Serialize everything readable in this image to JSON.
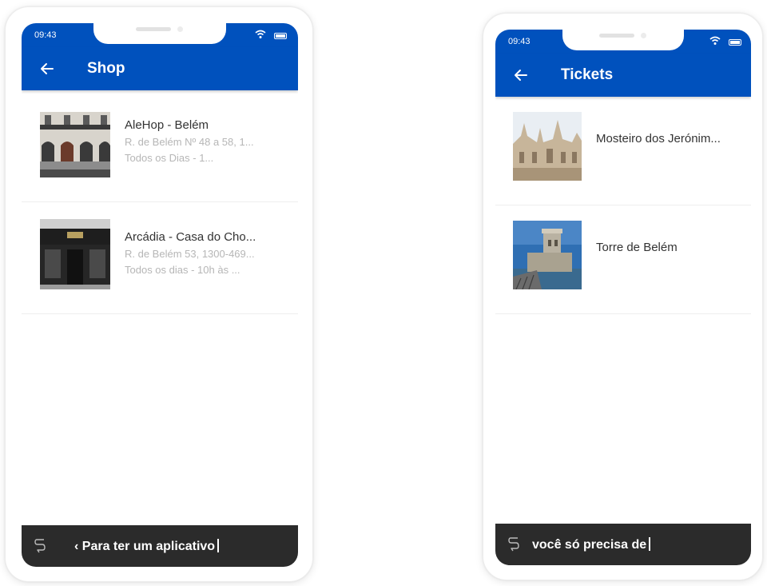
{
  "colors": {
    "app_bar": "#0051bd",
    "bottom_bar": "#2b2b2b",
    "title_text": "#333333",
    "subtitle_text": "#b6b6b6"
  },
  "left_phone": {
    "status": {
      "time": "09:43",
      "icons": [
        "wifi-icon",
        "battery-icon"
      ]
    },
    "app_bar": {
      "title": "Shop",
      "back_icon": "arrow-left-icon"
    },
    "items": [
      {
        "title": "AleHop - Belém",
        "subtitle1": "R. de Belém Nº 48 a 58, 1...",
        "subtitle2": "Todos os Dias - 1...",
        "image": "building-facade"
      },
      {
        "title": "Arcádia - Casa do Cho...",
        "subtitle1": "R. de Belém 53, 1300-469...",
        "subtitle2": "Todos os dias - 10h às ...",
        "image": "shop-front"
      }
    ],
    "bottom_bar": {
      "caption": "‹ Para ter um aplicativo",
      "logo_icon": "s-logo-icon"
    }
  },
  "right_phone": {
    "status": {
      "time": "09:43",
      "icons": [
        "wifi-icon",
        "battery-icon"
      ]
    },
    "app_bar": {
      "title": "Tickets",
      "back_icon": "arrow-left-icon"
    },
    "items": [
      {
        "title": "Mosteiro dos Jerónim...",
        "image": "monastery"
      },
      {
        "title": "Torre de Belém",
        "image": "tower"
      }
    ],
    "bottom_bar": {
      "caption": "você só precisa de",
      "logo_icon": "s-logo-icon"
    }
  }
}
